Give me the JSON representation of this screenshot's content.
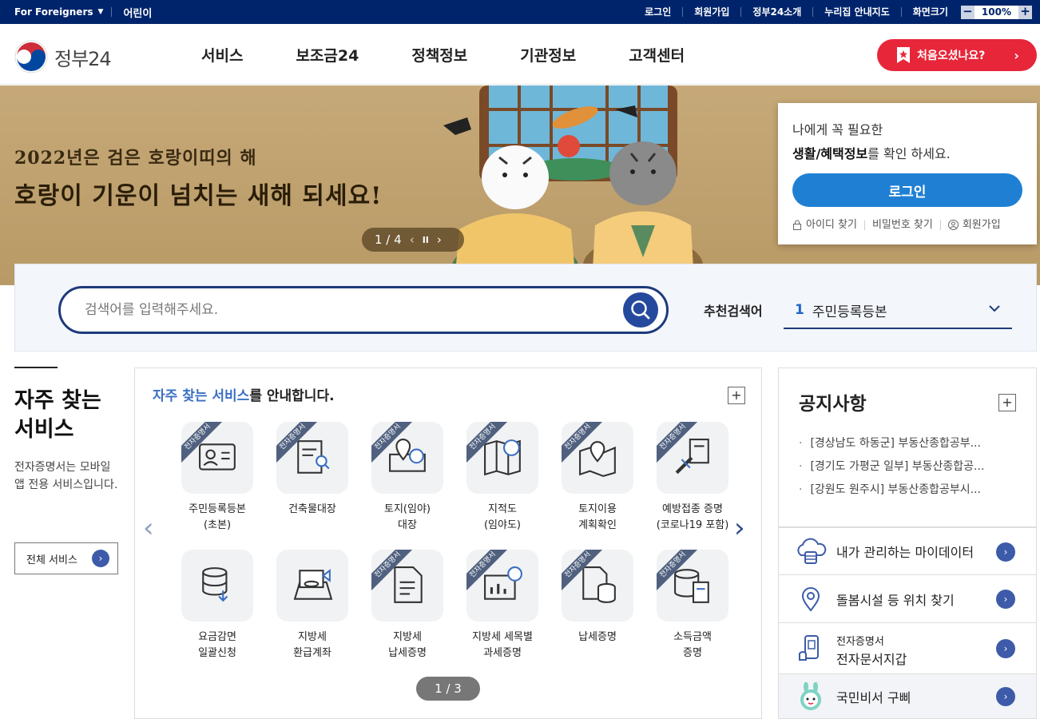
{
  "util": {
    "foreigners": "For Foreigners",
    "kids": "어린이",
    "links": [
      "로그인",
      "회원가입",
      "정부24소개",
      "누리집 안내지도"
    ],
    "zoom_label": "화면크기",
    "zoom_minus": "−",
    "zoom_value": "100%",
    "zoom_plus": "+"
  },
  "header": {
    "logo_text": "정부24",
    "menu": [
      "서비스",
      "보조금24",
      "정책정보",
      "기관정보",
      "고객센터"
    ],
    "first_visit": "처음오셨나요?"
  },
  "banner": {
    "line1": "2022년은 검은 호랑이띠의 해",
    "line2": "호랑이 기운이 넘치는 새해 되세요!",
    "pager": "1 / 4"
  },
  "login_card": {
    "msg1": "나에게 꼭 필요한",
    "msg2_bold": "생활/혜택정보",
    "msg2_rest": "를 확인 하세요.",
    "login_button": "로그인",
    "links": [
      "아이디 찾기",
      "비밀번호 찾기",
      "회원가입"
    ]
  },
  "search": {
    "placeholder": "검색어를 입력해주세요.",
    "recommend_label": "추천검색어",
    "recommend_num": "1",
    "recommend_term": "주민등록등본"
  },
  "side": {
    "title_line1": "자주 찾는",
    "title_line2": "서비스",
    "desc": "전자증명서는 모바일 앱 전용 서비스입니다.",
    "all_button": "전체 서비스"
  },
  "services": {
    "head_highlight": "자주 찾는 서비스",
    "head_rest": "를 안내합니다.",
    "ribbon": "전자증명서",
    "items": [
      {
        "l1": "주민등록등본",
        "l2": "(초본)",
        "ribbon": true
      },
      {
        "l1": "건축물대장",
        "l2": "",
        "ribbon": true
      },
      {
        "l1": "토지(임야)",
        "l2": "대장",
        "ribbon": true
      },
      {
        "l1": "지적도",
        "l2": "(임야도)",
        "ribbon": true
      },
      {
        "l1": "토지이용",
        "l2": "계획확인",
        "ribbon": true
      },
      {
        "l1": "예방접종 증명",
        "l2": "(코로나19 포함)",
        "ribbon": true
      },
      {
        "l1": "요금감면",
        "l2": "일괄신청",
        "ribbon": false
      },
      {
        "l1": "지방세",
        "l2": "환급계좌",
        "ribbon": false
      },
      {
        "l1": "지방세",
        "l2": "납세증명",
        "ribbon": true
      },
      {
        "l1": "지방세 세목별",
        "l2": "과세증명",
        "ribbon": true
      },
      {
        "l1": "납세증명",
        "l2": "",
        "ribbon": true
      },
      {
        "l1": "소득금액",
        "l2": "증명",
        "ribbon": true
      }
    ],
    "page": "1 / 3"
  },
  "notice": {
    "title": "공지사항",
    "items": [
      "[경상남도 하동군] 부동산종합공부...",
      "[경기도 가평군 일부] 부동산종합공...",
      "[강원도 원주시] 부동산종합공부시..."
    ]
  },
  "quick": [
    {
      "label": "내가 관리하는 마이데이터",
      "icon": "cloud-data-icon"
    },
    {
      "label": "돌봄시설 등 위치 찾기",
      "icon": "location-pin-icon"
    },
    {
      "label_small": "전자증명서",
      "label": "전자문서지갑",
      "icon": "phone-wallet-icon"
    },
    {
      "label": "국민비서 구삐",
      "icon": "gubbi-mascot-icon"
    }
  ],
  "colors": {
    "top_bar": "#00246b",
    "accent_red": "#e8263a",
    "login_blue": "#1f80d3",
    "navy": "#1e3a7b"
  }
}
